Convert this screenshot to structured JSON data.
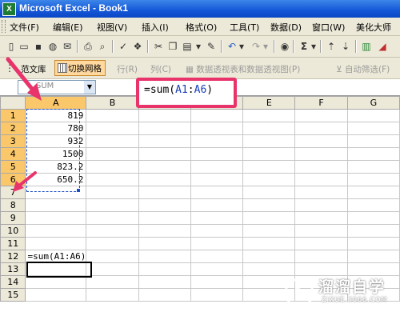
{
  "window": {
    "app_icon": "X",
    "title": "Microsoft Excel - Book1"
  },
  "menu": {
    "items": [
      "文件(F)",
      "编辑(E)",
      "视图(V)",
      "插入(I)",
      "格式(O)",
      "工具(T)",
      "数据(D)",
      "窗口(W)",
      "美化大师"
    ]
  },
  "toolbar": {
    "sum_symbol": "Σ"
  },
  "toolbar2": {
    "fanwenku": "范文库",
    "toggle_grid": "切换网格",
    "row": "行(R)",
    "col": "列(C)",
    "pivot": "数据透视表和数据透视图(P)",
    "autofilter": "自动筛选(F)"
  },
  "namebox": {
    "value": "SUM"
  },
  "callout": {
    "prefix": "=sum(",
    "ref1": "A1",
    "sep": ":",
    "ref2": "A6",
    "suffix": ")"
  },
  "sheet": {
    "columns": [
      "A",
      "B",
      "C",
      "D",
      "E",
      "F",
      "G"
    ],
    "rows": [
      "1",
      "2",
      "3",
      "4",
      "5",
      "6",
      "7",
      "8",
      "9",
      "10",
      "11",
      "12",
      "13",
      "14",
      "15"
    ],
    "cells": {
      "A1": "819",
      "A2": "780",
      "A3": "932",
      "A4": "1500",
      "A5": "823.2",
      "A6": "650.2",
      "A12": "=sum(A1:A6)"
    }
  },
  "watermark": {
    "brand": "溜溜自学",
    "url": "ZIXUE.3066.COM"
  },
  "colors": {
    "accent": "#e8336b",
    "title_bar": "#1456d8",
    "ref_blue": "#1a3fb8",
    "selection": "#1b4fc7"
  }
}
